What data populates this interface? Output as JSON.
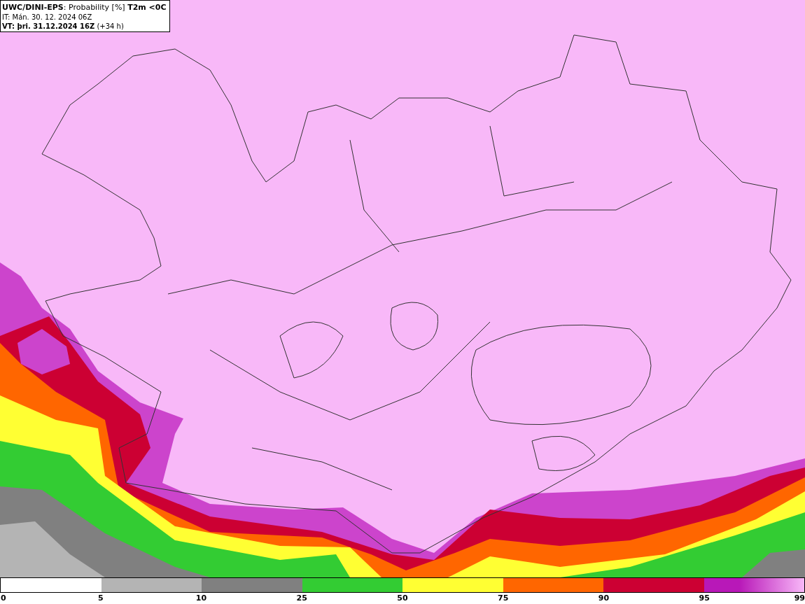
{
  "header": {
    "lines": [
      "**UWC/DINI-EPS**: Probability [%] **T2m <0C**",
      "IT: Mán. 30. 12. 2024 06Z",
      "**VT: þri. 31.12.2024 16Z** (+34 h)"
    ]
  },
  "legend": {
    "segments": [
      {
        "color": "#ffffff"
      },
      {
        "color": "#b4b4b4"
      },
      {
        "color": "#808080"
      },
      {
        "color": "#33cc33"
      },
      {
        "color": "#ffff33"
      },
      {
        "color": "#ff6600"
      },
      {
        "color": "#cc0033"
      },
      {
        "color": "#b818b8"
      }
    ],
    "labels": [
      "0",
      "5",
      "10",
      "25",
      "50",
      "75",
      "90",
      "95",
      "99"
    ]
  }
}
